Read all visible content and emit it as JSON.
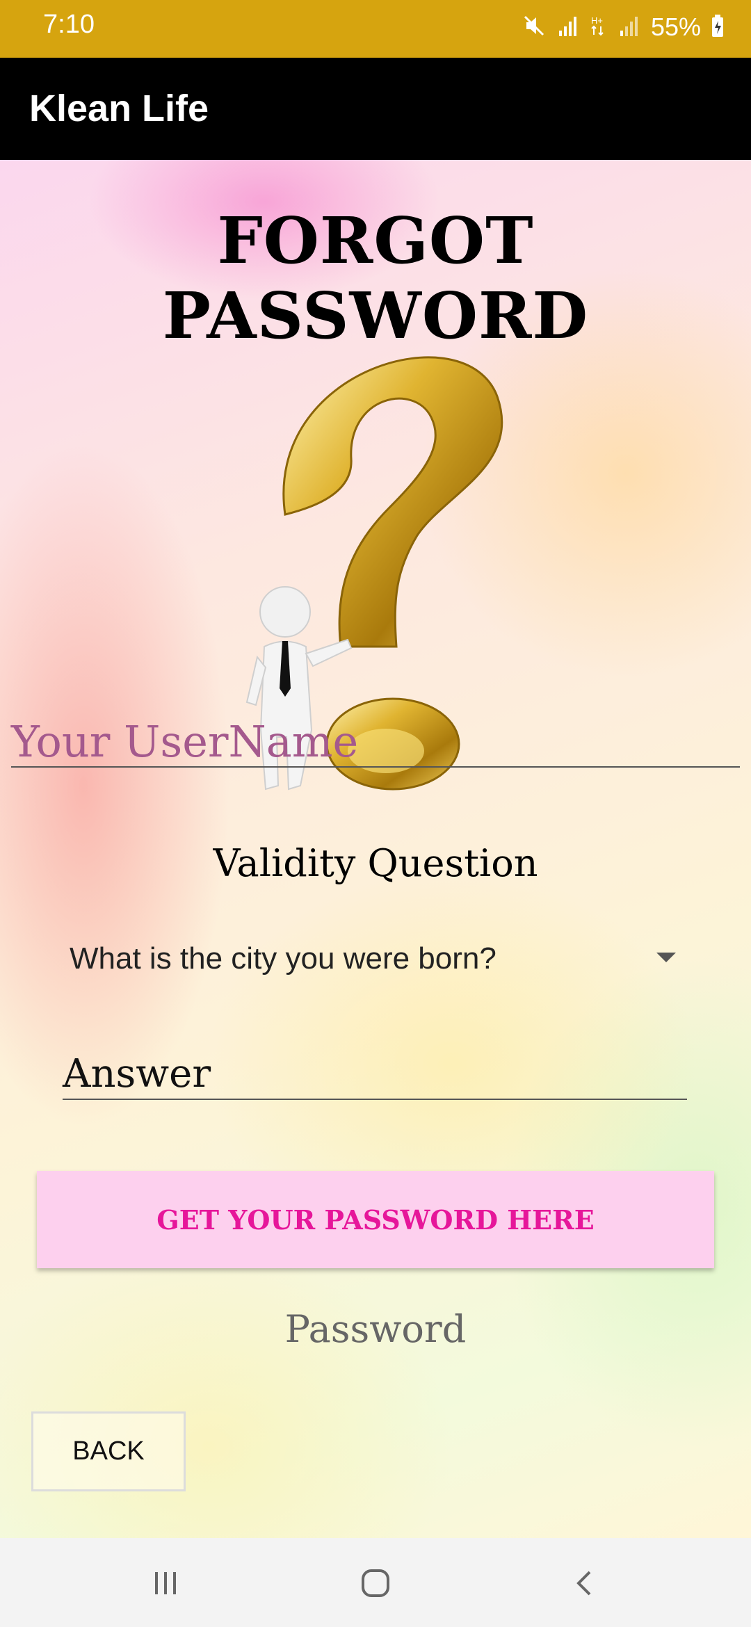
{
  "status_bar": {
    "time": "7:10",
    "battery_percent": "55%",
    "icons": [
      "mute-icon",
      "signal-icon",
      "hplus-data-icon",
      "signal-icon",
      "battery-charging-icon"
    ]
  },
  "app_bar": {
    "title": "Klean Life"
  },
  "page": {
    "title": "FORGOT PASSWORD",
    "illustration": "question-mark-with-figure-illustration",
    "username_placeholder": "Your UserName",
    "validity_label": "Validity Question",
    "question_selected": "What is the city you were born?",
    "answer_placeholder": "Answer",
    "get_password_button": "GET YOUR PASSWORD HERE",
    "password_output": "Password",
    "back_button": "BACK"
  },
  "nav_bar": {
    "icons": [
      "recents-icon",
      "home-icon",
      "back-icon"
    ]
  },
  "colors": {
    "status_bar": "#d6a40f",
    "app_bar": "#000000",
    "username_placeholder": "#a4598d",
    "button_bg": "#fdd0ee",
    "button_text": "#e6169a"
  }
}
